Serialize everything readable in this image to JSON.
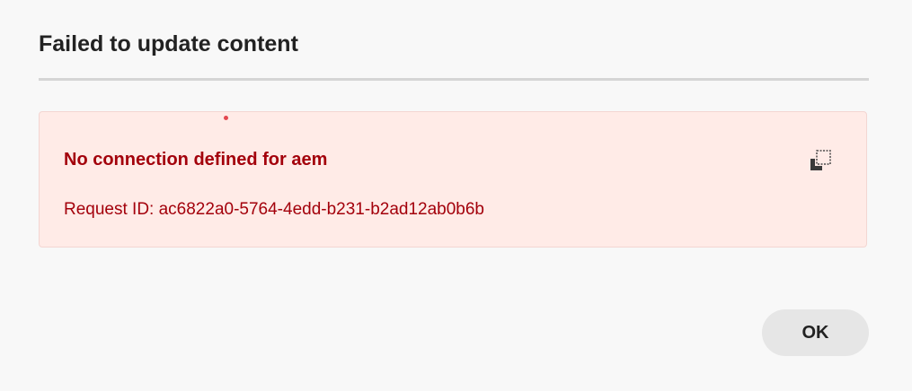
{
  "dialog": {
    "title": "Failed to update content",
    "error": {
      "message": "No connection defined for aem",
      "request_id_label": "Request ID:",
      "request_id": "ac6822a0-5764-4edd-b231-b2ad12ab0b6b",
      "copy_icon": "copy-icon"
    },
    "ok_label": "OK"
  },
  "colors": {
    "background": "#f8f8f8",
    "error_background": "#ffebe7",
    "error_text": "#a3000b",
    "button_background": "#e6e6e6"
  }
}
